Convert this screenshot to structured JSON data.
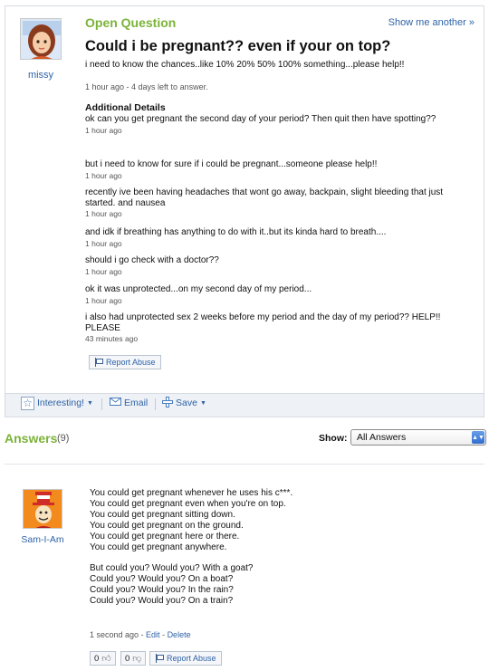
{
  "question": {
    "status_label": "Open Question",
    "show_another": "Show me another »",
    "asker_name": "missy",
    "title": "Could i be pregnant?? even if your on top?",
    "body": "i need to know the chances..like 10% 20% 50% 100% something...please help!!",
    "meta": "1 hour ago - 4 days left to answer.",
    "additional_details_heading": "Additional Details",
    "details": [
      {
        "text": "ok can you get pregnant the second day of your period? Then quit then have spotting??",
        "time": "1 hour ago"
      },
      {
        "text": "but i need to know for sure if i could be pregnant...someone please help!!",
        "time": "1 hour ago"
      },
      {
        "text": "recently ive been having headaches that wont go away, backpain, slight bleeding that just started. and nausea",
        "time": "1 hour ago"
      },
      {
        "text": "and idk if breathing has anything to do with it..but its kinda hard to breath....",
        "time": "1 hour ago"
      },
      {
        "text": "should i go check with a doctor??",
        "time": "1 hour ago"
      },
      {
        "text": "ok it was unprotected...on my second day of my period...",
        "time": "1 hour ago"
      },
      {
        "text": "i also had unprotected sex 2 weeks before my period and the day of my period?? HELP!! PLEASE",
        "time": "43 minutes ago"
      }
    ],
    "report_abuse": "Report Abuse",
    "footer": {
      "interesting": "Interesting!",
      "email": "Email",
      "save": "Save"
    }
  },
  "answers_section": {
    "title": "Answers",
    "count": "(9)",
    "show_label": "Show:",
    "show_value": "All Answers"
  },
  "answer": {
    "author": "Sam-I-Am",
    "stanza1": [
      "You could get pregnant whenever he uses his c***.",
      "You could get pregnant even when you're on top.",
      "You could get pregnant sitting down.",
      "You could get pregnant on the ground.",
      "You could get pregnant here or there.",
      "You could get pregnant anywhere."
    ],
    "stanza2": [
      "But could you? Would you? With a goat?",
      "Could you? Would you? On a boat?",
      "Could you? Would you? In the rain?",
      "Could you? Would you? On a train?"
    ],
    "meta_time": "1 second ago - ",
    "edit": "Edit",
    "delete": "Delete",
    "thumbs_up_count": "0",
    "thumbs_down_count": "0",
    "report_abuse": "Report Abuse"
  },
  "icons": {
    "interesting": "star-icon",
    "email": "envelope-icon",
    "save": "plus-folder-icon",
    "report": "flag-icon"
  },
  "colors": {
    "accent_green": "#7bb338",
    "link_blue": "#2f63a8"
  }
}
